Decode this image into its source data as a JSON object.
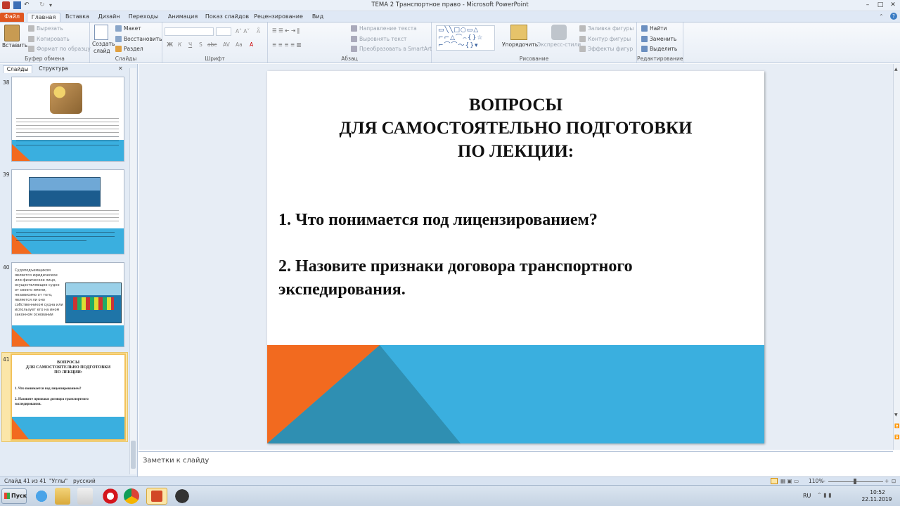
{
  "window": {
    "title": "ТЕМА 2 Транспортное право  -  Microsoft PowerPoint"
  },
  "tabs": [
    {
      "label": "Файл"
    },
    {
      "label": "Главная"
    },
    {
      "label": "Вставка"
    },
    {
      "label": "Дизайн"
    },
    {
      "label": "Переходы"
    },
    {
      "label": "Анимация"
    },
    {
      "label": "Показ слайдов"
    },
    {
      "label": "Рецензирование"
    },
    {
      "label": "Вид"
    }
  ],
  "ribbon": {
    "clipboard": {
      "label": "Буфер обмена",
      "paste": "Вставить",
      "cut": "Вырезать",
      "copy": "Копировать",
      "format_painter": "Формат по образцу"
    },
    "slides": {
      "label": "Слайды",
      "new_slide": "Создать",
      "new_slide2": "слайд",
      "layout": "Макет",
      "reset": "Восстановить",
      "section": "Раздел"
    },
    "font": {
      "label": "Шрифт",
      "bold": "Ж",
      "italic": "К",
      "underline": "Ч",
      "strike": "S",
      "shadow": "abc"
    },
    "paragraph": {
      "label": "Абзац",
      "text_direction": "Направление текста",
      "align_text": "Выровнять текст",
      "smartart": "Преобразовать в SmartArt"
    },
    "drawing": {
      "label": "Рисование",
      "arrange": "Упорядочить",
      "quick_styles": "Экспресс-стили",
      "shape_fill": "Заливка фигуры",
      "shape_outline": "Контур фигуры",
      "shape_effects": "Эффекты фигур"
    },
    "editing": {
      "label": "Редактирование",
      "find": "Найти",
      "replace": "Заменить",
      "select": "Выделить"
    }
  },
  "panel": {
    "tab_slides": "Слайды",
    "tab_outline": "Структура"
  },
  "thumbnails": [
    {
      "num": "38"
    },
    {
      "num": "39"
    },
    {
      "num": "40",
      "text": "Судоподъемщиком является юридическое или физическое лицо, осуществляющее судно от своего имени, независимо от того, является ли оно собственником судна или использует его на ином законном основании"
    },
    {
      "num": "41",
      "title1": "ВОПРОСЫ",
      "title2": "ДЛЯ САМОСТОЯТЕЛЬНО ПОДГОТОВКИ",
      "title3": "ПО ЛЕКЦИИ:",
      "q1": "1. Что понимается под лицензированием?",
      "q2": "2. Назовите признаки договора транспортного экспедирования."
    }
  ],
  "slide": {
    "title_line1": "ВОПРОСЫ",
    "title_line2": "ДЛЯ САМОСТОЯТЕЛЬНО ПОДГОТОВКИ",
    "title_line3": "ПО ЛЕКЦИИ:",
    "q1": "1. Что понимается под лицензированием?",
    "q2_line1": "2. Назовите признаки договора транспортного",
    "q2_line2": "экспедирования.",
    "colors": {
      "orange": "#f26a1f",
      "blue": "#3aafdf",
      "teal": "#2f8fb2"
    }
  },
  "notes": {
    "placeholder": "Заметки к слайду"
  },
  "status": {
    "slide_info": "Слайд 41 из 41",
    "theme": "\"Углы\"",
    "language": "русский",
    "zoom": "110%"
  },
  "taskbar": {
    "start": "Пуск",
    "lang": "RU",
    "time": "10:52",
    "date": "22.11.2019"
  }
}
